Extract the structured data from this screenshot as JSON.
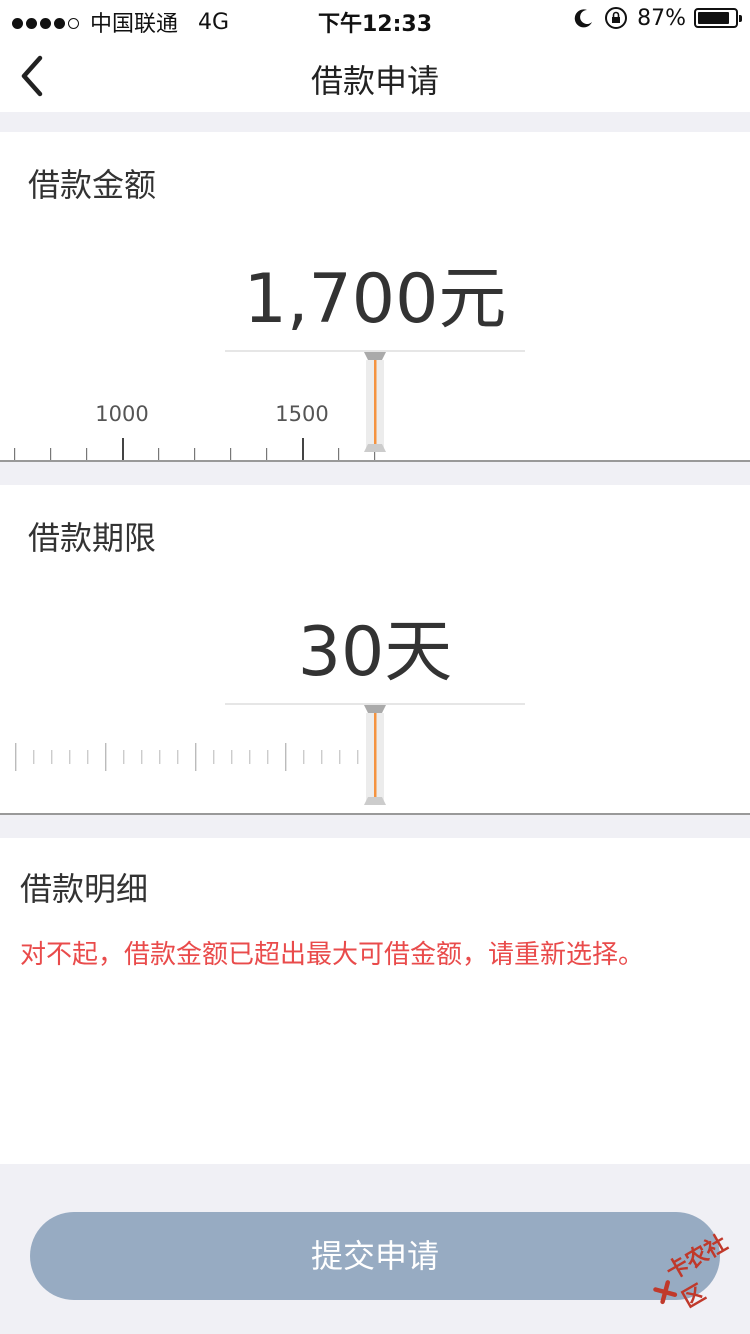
{
  "status_bar": {
    "carrier": "中国联通",
    "network": "4G",
    "time": "下午12:33",
    "battery": "87%",
    "battery_level": 0.87,
    "signal_bars": 4,
    "signal_total": 5
  },
  "nav": {
    "title": "借款申请",
    "back_icon": "chevron-left-icon"
  },
  "amount": {
    "label": "借款金额",
    "value": "1,700元",
    "ruler_labels": [
      "1000",
      "1500"
    ],
    "accent_color": "#f5933f"
  },
  "term": {
    "label": "借款期限",
    "value": "30天"
  },
  "detail": {
    "label": "借款明细",
    "error": "对不起，借款金额已超出最大可借金额，请重新选择。",
    "error_color": "#e94b4b"
  },
  "submit": {
    "label": "提交申请",
    "color": "#97abc2"
  },
  "watermark": {
    "text": "卡农社区"
  }
}
